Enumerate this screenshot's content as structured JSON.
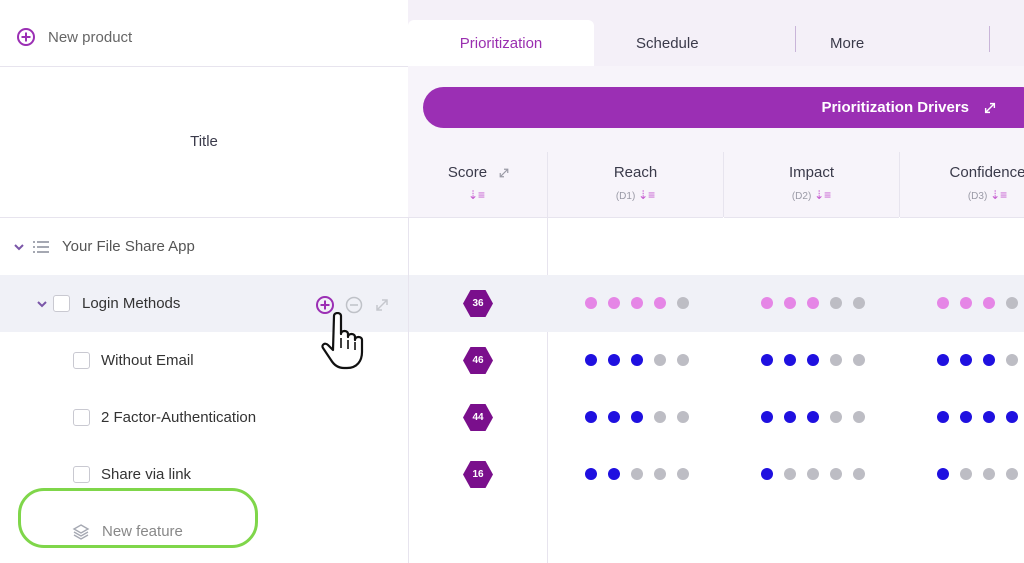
{
  "left": {
    "new_product_label": "New product",
    "title_header": "Title",
    "group": {
      "label": "Your File Share App"
    },
    "items": [
      {
        "label": "Login Methods",
        "score": "36"
      },
      {
        "label": "Without Email",
        "score": "46"
      },
      {
        "label": "2 Factor-Authentication",
        "score": "44"
      },
      {
        "label": "Share via link",
        "score": "16"
      }
    ],
    "new_feature_label": "New feature"
  },
  "tabs": [
    {
      "label": "Prioritization",
      "active": true
    },
    {
      "label": "Schedule",
      "active": false
    },
    {
      "label": "More",
      "active": false
    }
  ],
  "drivers": {
    "bar_label": "Prioritization Drivers"
  },
  "columns": {
    "score": {
      "name": "Score"
    },
    "reach": {
      "name": "Reach",
      "sub": "(D1)"
    },
    "impact": {
      "name": "Impact",
      "sub": "(D2)"
    },
    "confidence": {
      "name": "Confidence",
      "sub": "(D3)"
    }
  },
  "ratings": [
    {
      "reach": 4,
      "impact": 3,
      "confidence": 3,
      "color": "#e586e6"
    },
    {
      "reach": 3,
      "impact": 3,
      "confidence": 3,
      "color": "#1f10e0"
    },
    {
      "reach": 3,
      "impact": 3,
      "confidence": 4,
      "color": "#1f10e0"
    },
    {
      "reach": 2,
      "impact": 1,
      "confidence": 1,
      "color": "#1f10e0"
    }
  ],
  "colors": {
    "accent": "#9b2fb4",
    "hex_badge": "#7a0f8c",
    "highlight_ring": "#7fd64a"
  }
}
